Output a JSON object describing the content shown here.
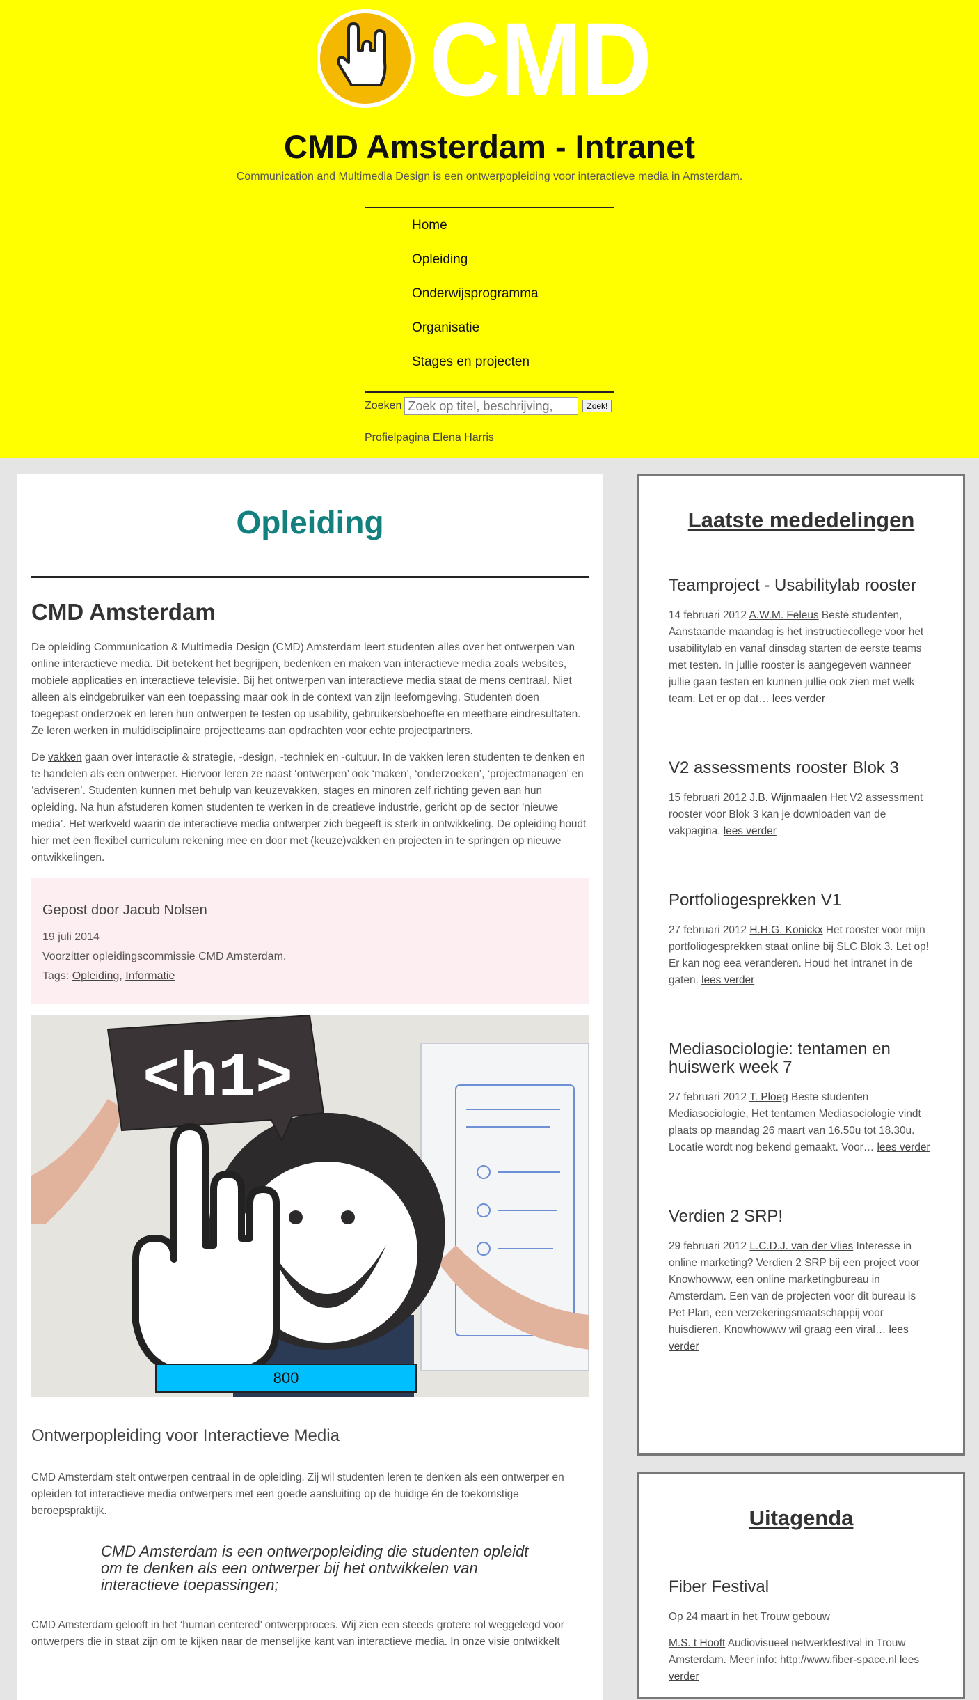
{
  "site": {
    "title": "CMD Amsterdam - Intranet",
    "subtitle": "Communication and Multimedia Design is een ontwerpopleiding voor interactieve media in Amsterdam.",
    "logo_text": "CMD",
    "accent": "#ffff00"
  },
  "nav": {
    "items": [
      "Home",
      "Opleiding",
      "Onderwijsprogramma",
      "Organisatie",
      "Stages en projecten"
    ]
  },
  "search": {
    "label": "Zoeken",
    "placeholder": "Zoek op titel, beschrijving,",
    "button": "Zoek!"
  },
  "profile": {
    "link": "Profielpagina Elena Harris"
  },
  "main": {
    "title": "Opleiding",
    "section_title": "CMD Amsterdam",
    "p1": "De opleiding Communication & Multimedia Design (CMD) Amsterdam leert studenten alles over het ontwerpen van online interactieve media. Dit betekent het begrijpen, bedenken en maken van interactieve media zoals websites, mobiele applicaties en interactieve televisie. Bij het ontwerpen van interactieve media staat de mens centraal. Niet alleen als eindgebruiker van een toepassing maar ook in de context van zijn leefomgeving. Studenten doen toegepast onderzoek en leren hun ontwerpen te testen op usability, gebruikersbehoefte en meetbare eindresultaten. Ze leren werken in multidisciplinaire projectteams aan opdrachten voor echte projectpartners.",
    "p2_before": "De ",
    "p2_link": "vakken",
    "p2_after": " gaan over interactie & strategie, -design, -techniek en -cultuur. In de vakken leren studenten te denken en te handelen als een ontwerper. Hiervoor leren ze naast ‘ontwerpen’ ook ‘maken’, ‘onderzoeken’, ‘projectmanagen’ en ‘adviseren’. Studenten kunnen met behulp van keuzevakken, stages en minoren zelf richting geven aan hun opleiding. Na hun afstuderen komen studenten te werken in de creatieve industrie, gericht op de sector ‘nieuwe media’. Het werkveld waarin de interactieve media ontwerper zich begeeft is sterk in ontwikkeling. De opleiding houdt hier met een flexibel curriculum rekening mee en door met (keuze)vakken en projecten in te springen op nieuwe ontwikkelingen.",
    "author": {
      "posted_by": "Gepost door Jacub Nolsen",
      "date": "19 juli 2014",
      "role": "Voorzitter opleidingscommissie CMD Amsterdam.",
      "tags_label": "Tags:",
      "tag1": "Opleiding",
      "tag_sep": ",",
      "tag2": "Informatie"
    },
    "image": {
      "sign_text": "<h1>",
      "badge": "800"
    },
    "subtitle": "Ontwerpopleiding voor Interactieve Media",
    "p3": "CMD Amsterdam stelt ontwerpen centraal in de opleiding. Zij wil studenten leren te denken als een ontwerper en opleiden tot interactieve media ontwerpers met een goede aansluiting op de huidige én de toekomstige beroepspraktijk.",
    "quote": "CMD Amsterdam is een ontwerpopleiding die studenten opleidt om te denken als een ontwerper bij het ontwikkelen van interactieve toepassingen;",
    "p4": "CMD Amsterdam gelooft in het ‘human centered’ ontwerpproces. Wij zien een steeds grotere rol weggelegd voor ontwerpers die in staat zijn om te kijken naar de menselijke kant van interactieve media. In onze visie ontwikkelt"
  },
  "news": {
    "title": "Laatste mededelingen",
    "read_more": "lees verder",
    "items": [
      {
        "title": "Teamproject - Usabilitylab rooster",
        "date": "14 februari 2012",
        "author": "A.W.M. Feleus",
        "text": " Beste studenten, Aanstaande maandag is het instructiecollege voor het usabilitylab en vanaf dinsdag starten de eerste teams met testen. In jullie rooster is aangegeven wanneer jullie gaan testen en kunnen jullie ook zien met welk team. Let er op dat… "
      },
      {
        "title": "V2 assessments rooster Blok 3",
        "date": "15 februari 2012",
        "author": "J.B. Wijnmaalen",
        "text": " Het V2 assessment rooster voor Blok 3 kan je downloaden van de vakpagina. "
      },
      {
        "title": "Portfoliogesprekken V1",
        "date": "27 februari 2012",
        "author": "H.H.G. Konickx",
        "text": " Het rooster voor mijn portfoliogesprekken staat online bij SLC Blok 3. Let op! Er kan nog eea veranderen. Houd het intranet in de gaten. "
      },
      {
        "title": "Mediasociologie: tentamen en huiswerk week 7",
        "date": "27 februari 2012",
        "author": "T. Ploeg",
        "text": " Beste studenten Mediasociologie, Het tentamen Mediasociologie vindt plaats op maandag 26 maart van 16.50u tot 18.30u. Locatie wordt nog bekend gemaakt. Voor… "
      },
      {
        "title": "Verdien 2 SRP!",
        "date": "29 februari 2012",
        "author": "L.C.D.J. van der Vlies",
        "text": " Interesse in online marketing? Verdien 2 SRP bij een project voor Knowhowww, een online marketingbureau in Amsterdam. Een van de projecten voor dit bureau is Pet Plan, een verzekeringsmaatschappij voor huisdieren. Knowhowww wil graag een viral… "
      }
    ]
  },
  "agenda": {
    "title": "Uitagenda",
    "item_title": "Fiber Festival",
    "item_when": "Op 24 maart in het Trouw gebouw",
    "item_author": "M.S. t Hooft",
    "item_text": " Audiovisueel netwerkfestival in Trouw Amsterdam. Meer info: http://www.fiber-space.nl ",
    "read_more": "lees verder"
  }
}
